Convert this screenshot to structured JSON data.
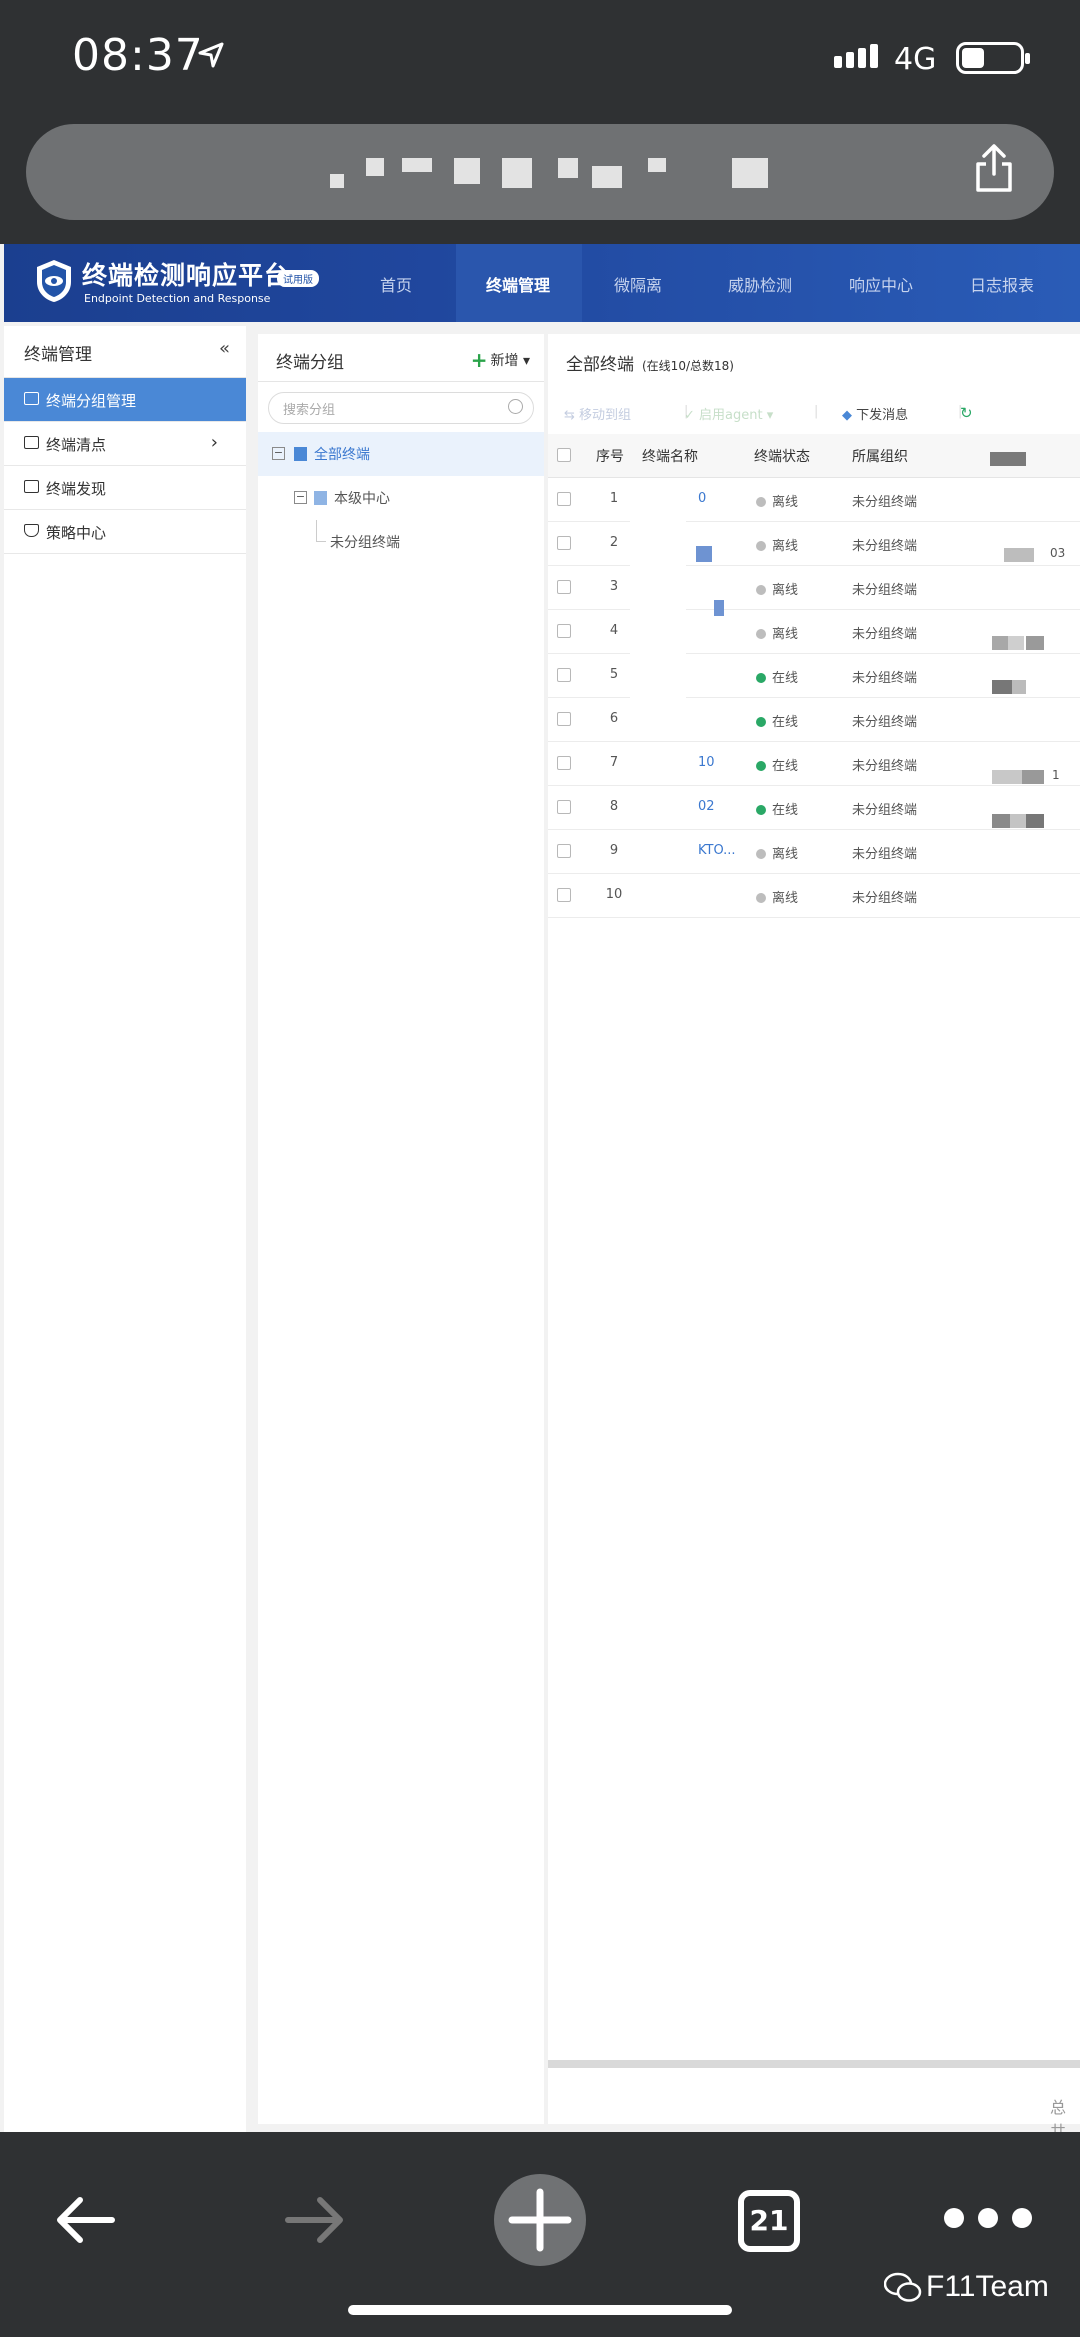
{
  "status_bar": {
    "time": "08:37",
    "network": "4G"
  },
  "browser": {
    "tabs_count": "21"
  },
  "watermark": "F11Team",
  "header": {
    "brand_cn": "终端检测响应平台",
    "brand_en": "Endpoint Detection and Response",
    "badge": "试用版",
    "nav": [
      "首页",
      "终端管理",
      "微隔离",
      "威胁检测",
      "响应中心",
      "日志报表"
    ],
    "active_nav": "终端管理"
  },
  "sidebar": {
    "title": "终端管理",
    "collapse_icon": "«",
    "items": [
      {
        "label": "终端分组管理",
        "icon": "monitor-group-icon",
        "active": true
      },
      {
        "label": "终端清点",
        "icon": "monitor-icon",
        "active": false
      },
      {
        "label": "终端发现",
        "icon": "search-doc-icon",
        "active": false
      },
      {
        "label": "策略中心",
        "icon": "shield-icon",
        "active": false
      }
    ]
  },
  "group_panel": {
    "title": "终端分组",
    "add_label": "新增",
    "search_placeholder": "搜索分组",
    "tree": [
      "全部终端",
      "本级中心",
      "未分组终端"
    ]
  },
  "list_panel": {
    "title": "全部终端",
    "count": "(在线10/总数18)",
    "toolbar": [
      "移动到组",
      "启用agent",
      "下发消息"
    ],
    "columns": [
      "序号",
      "终端名称",
      "终端状态",
      "所属组织"
    ],
    "rows": [
      {
        "no": "1",
        "name": "0",
        "status": "离线",
        "online": false,
        "org": "未分组终端"
      },
      {
        "no": "2",
        "name": "",
        "status": "离线",
        "online": false,
        "org": "未分组终端"
      },
      {
        "no": "3",
        "name": "",
        "status": "离线",
        "online": false,
        "org": "未分组终端"
      },
      {
        "no": "4",
        "name": "",
        "status": "离线",
        "online": false,
        "org": "未分组终端"
      },
      {
        "no": "5",
        "name": "",
        "status": "在线",
        "online": true,
        "org": "未分组终端"
      },
      {
        "no": "6",
        "name": "",
        "status": "在线",
        "online": true,
        "org": "未分组终端"
      },
      {
        "no": "7",
        "name": "10",
        "status": "在线",
        "online": true,
        "org": "未分组终端"
      },
      {
        "no": "8",
        "name": "02",
        "status": "在线",
        "online": true,
        "org": "未分组终端"
      },
      {
        "no": "9",
        "name": "KTO...",
        "status": "离线",
        "online": false,
        "org": "未分组终端"
      },
      {
        "no": "10",
        "name": "",
        "status": "离线",
        "online": false,
        "org": "未分组终端"
      }
    ],
    "extra_fragments": [
      "03",
      "1"
    ],
    "footer_fragment": "总共"
  }
}
